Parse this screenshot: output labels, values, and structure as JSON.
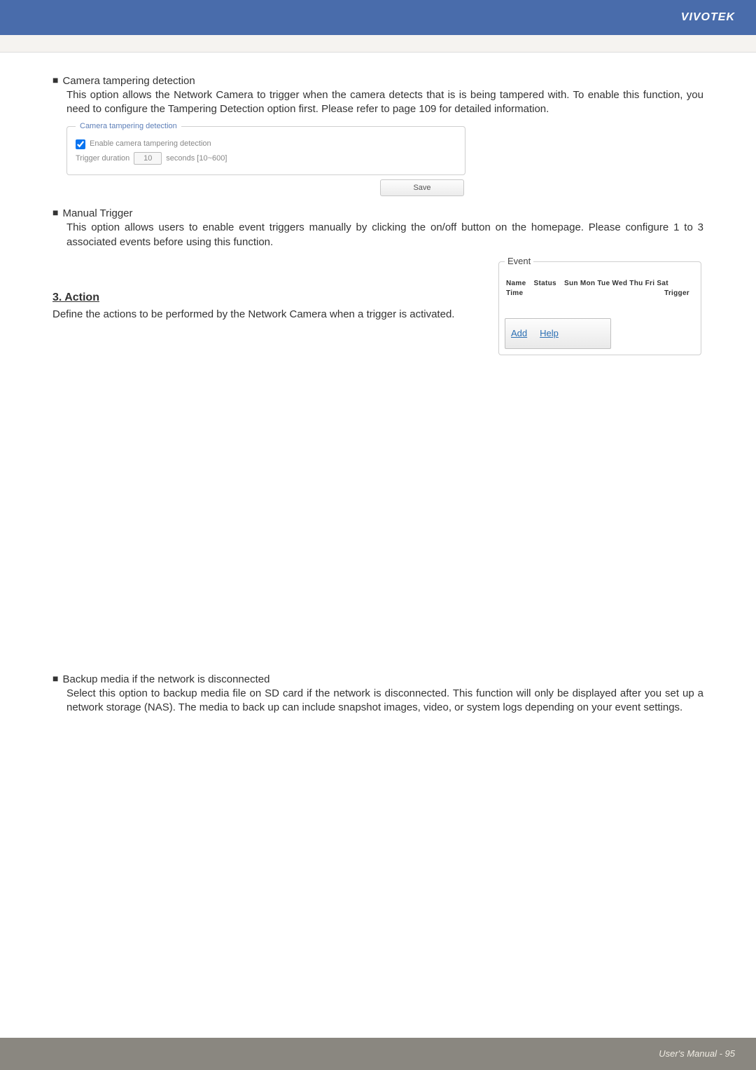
{
  "brand": "VIVOTEK",
  "section1": {
    "title": "Camera tampering detection",
    "desc": "This option allows the Network Camera to trigger when the camera detects that is is being tampered with. To enable this function, you need to configure the Tampering Detection option first. Please refer to page 109 for detailed information."
  },
  "tamper": {
    "legend": "Camera tampering detection",
    "enable_label": "Enable camera tampering detection",
    "td_label": "Trigger duration",
    "td_value": "10",
    "td_unit": "seconds [10~600]",
    "save_label": "Save"
  },
  "section2": {
    "title": "Manual Trigger",
    "desc": "This option allows users to enable event triggers manually by clicking the on/off button on the homepage. Please configure 1 to 3 associated events before using this function."
  },
  "event": {
    "legend": "Event",
    "cols": {
      "name": "Name",
      "status": "Status",
      "days": "Sun Mon Tue Wed Thu Fri Sat",
      "time": "Time",
      "trigger": "Trigger"
    },
    "add_label": "Add",
    "help_label": "Help"
  },
  "section3": {
    "heading": "3. Action",
    "desc": "Define the actions to be performed by the Network Camera when a trigger is activated."
  },
  "section4": {
    "title": "Backup media if the network is disconnected",
    "desc": "Select this option to backup media file on SD card if the network is disconnected. This function will only be displayed after you set up a network storage (NAS). The media to back up can include snapshot images, video, or system logs depending on your event settings."
  },
  "footer": "User's Manual - 95"
}
